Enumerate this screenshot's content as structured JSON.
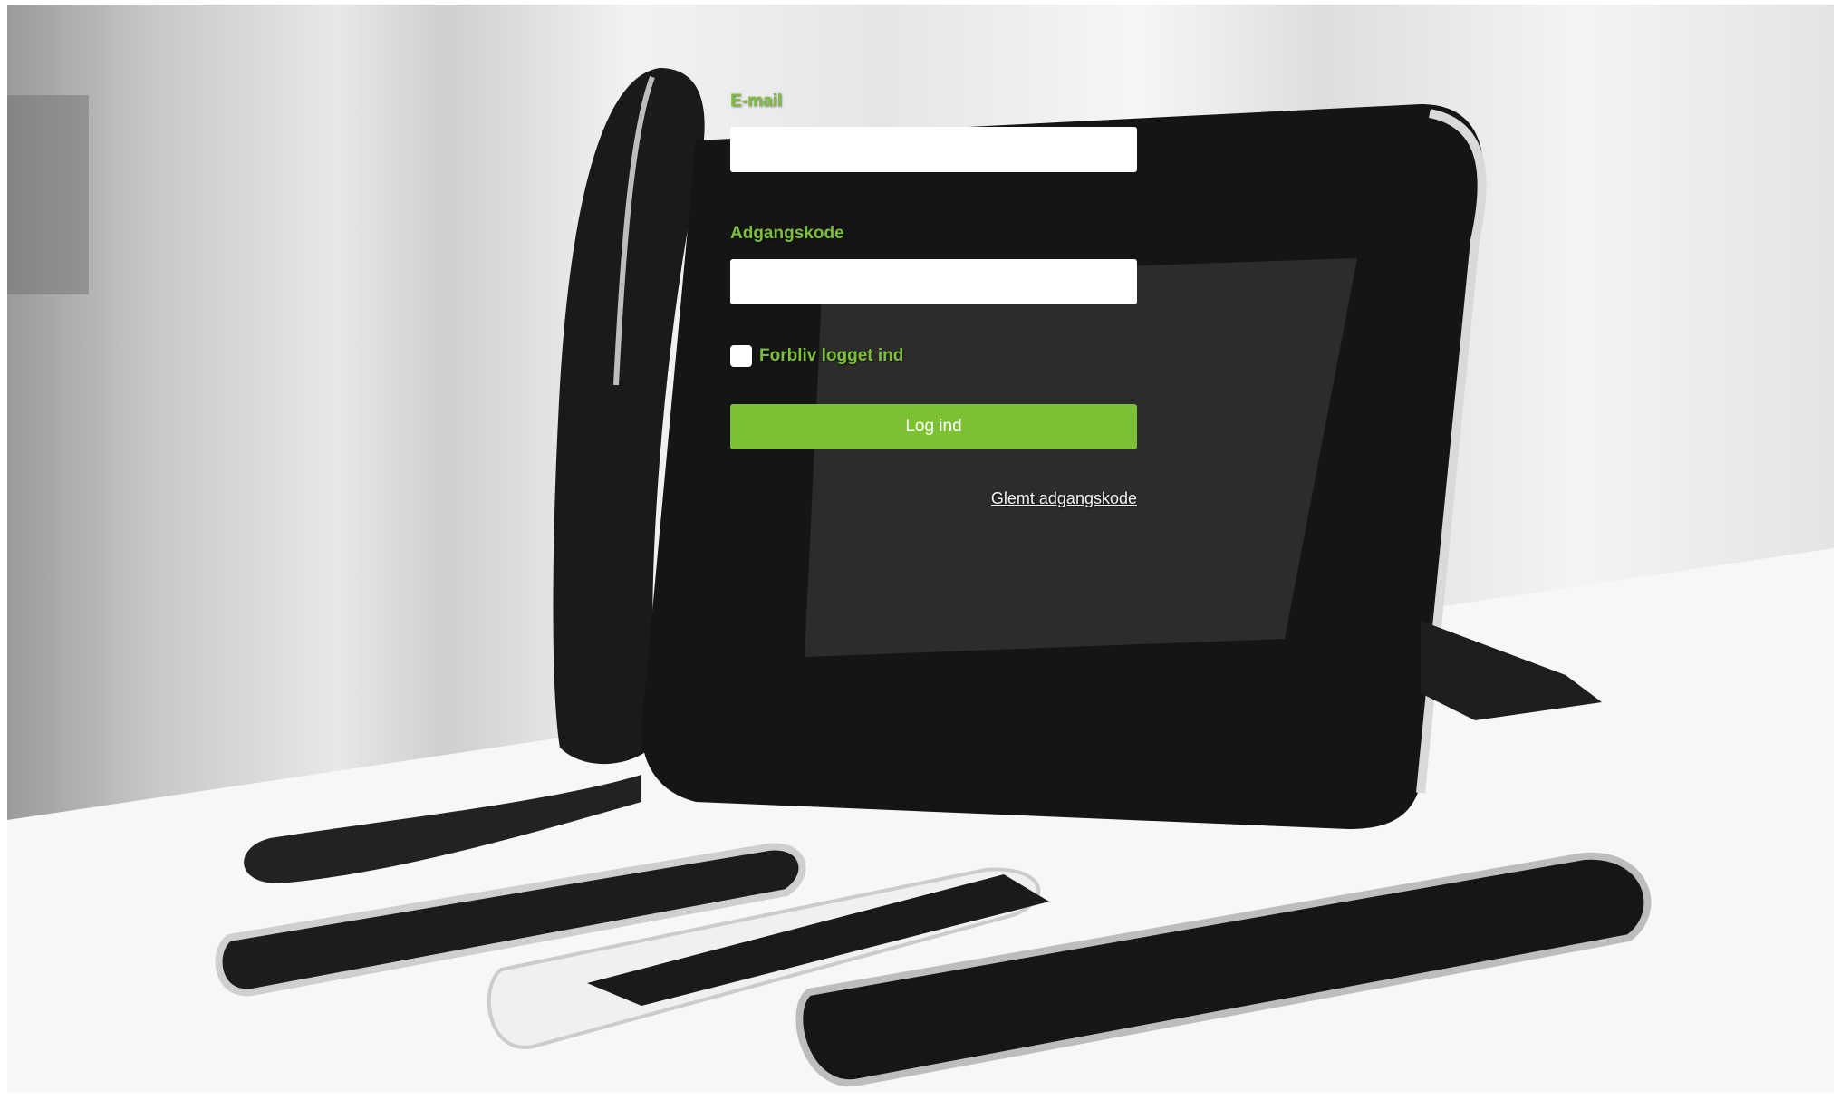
{
  "login": {
    "email_label": "E-mail",
    "email_value": "",
    "password_label": "Adgangskode",
    "password_value": "",
    "remember_label": "Forbliv logget ind",
    "remember_checked": false,
    "submit_label": "Log ind",
    "forgot_label": "Glemt adgangskode"
  },
  "colors": {
    "accent": "#7cc034",
    "label_green": "#7cc03a"
  },
  "background": {
    "image_icon": "desk-phone-and-smartphones-photo"
  }
}
